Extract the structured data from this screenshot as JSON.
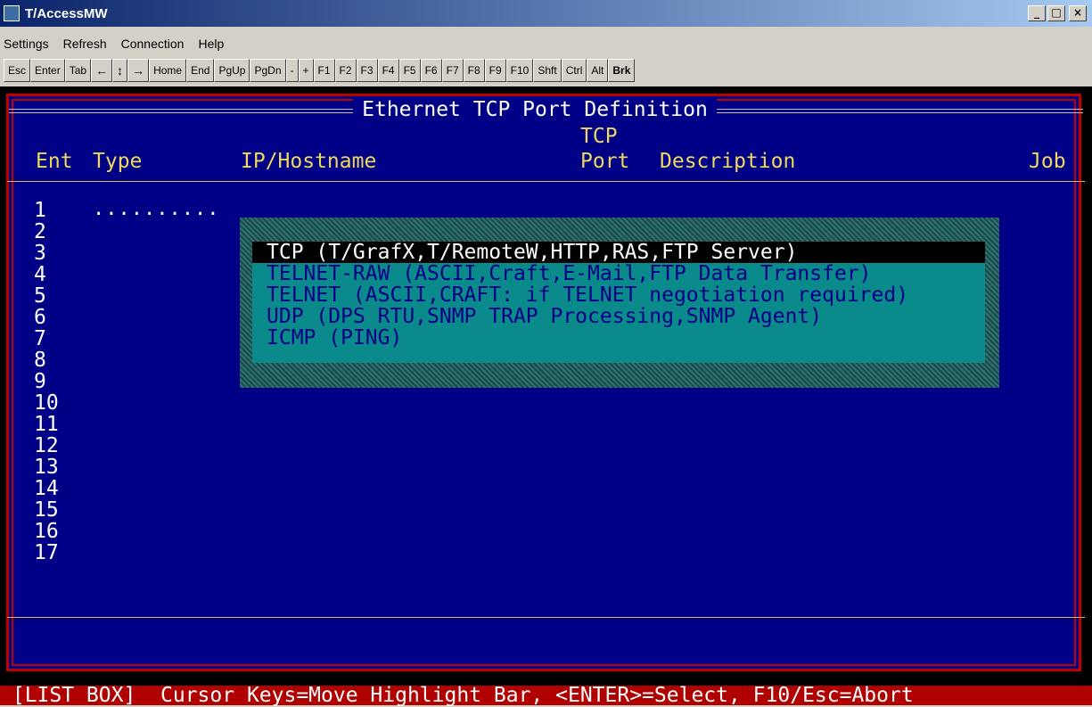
{
  "window": {
    "title": "T/AccessMW"
  },
  "menu": [
    "Settings",
    "Refresh",
    "Connection",
    "Help"
  ],
  "toolbar": {
    "keys": [
      "Esc",
      "Enter",
      "Tab",
      "←",
      "↕",
      "→",
      "Home",
      "End",
      "PgUp",
      "PgDn",
      "-",
      "+",
      "F1",
      "F2",
      "F3",
      "F4",
      "F5",
      "F6",
      "F7",
      "F8",
      "F9",
      "F10",
      "Shft",
      "Ctrl",
      "Alt",
      "Brk"
    ]
  },
  "screen": {
    "title": "Ethernet TCP Port Definition",
    "headers": {
      "ent": "Ent",
      "type": "Type",
      "ip": "IP/Hostname",
      "tcp": "TCP",
      "port": "Port",
      "desc": "Description",
      "job": "Job"
    },
    "entries": [
      "1",
      "2",
      "3",
      "4",
      "5",
      "6",
      "7",
      "8",
      "9",
      "10",
      "11",
      "12",
      "13",
      "14",
      "15",
      "16",
      "17"
    ],
    "entry1_type": ".........."
  },
  "listbox": {
    "options": [
      "TCP (T/GrafX,T/RemoteW,HTTP,RAS,FTP Server)",
      "TELNET-RAW (ASCII,Craft,E-Mail,FTP Data Transfer)",
      "TELNET (ASCII,CRAFT: if TELNET negotiation required)",
      "UDP (DPS RTU,SNMP TRAP Processing,SNMP Agent)",
      "ICMP (PING)"
    ],
    "selected_index": 0
  },
  "status": {
    "text": " [LIST BOX]  Cursor Keys=Move Highlight Bar, <ENTER>=Select, F10/Esc=Abort"
  },
  "colors": {
    "background": "#000087",
    "frame": "#c00000",
    "header": "#f0d860",
    "listbox": "#0a8a8a",
    "status": "#b00000"
  }
}
